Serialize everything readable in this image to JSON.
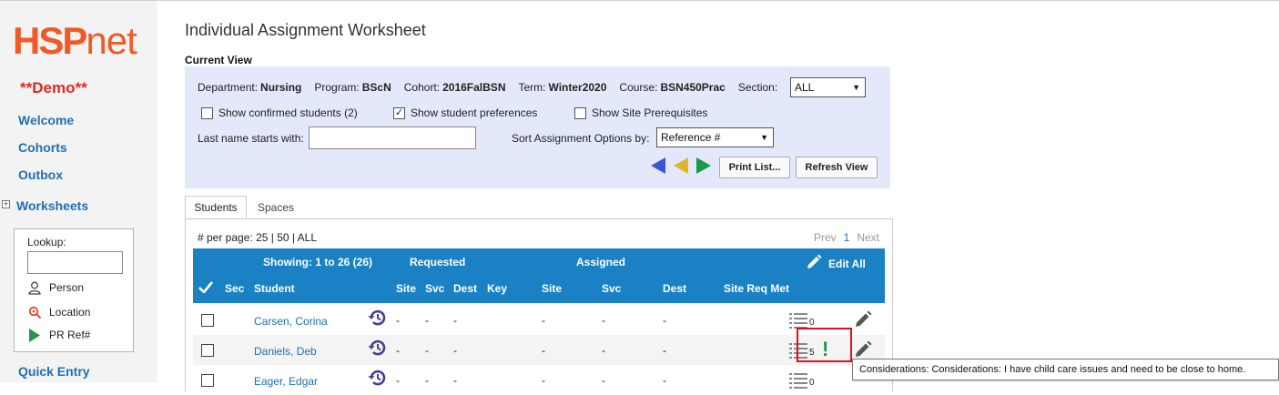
{
  "logo": {
    "part1": "HSP",
    "part2": "net"
  },
  "demo_label": "**Demo**",
  "nav": {
    "welcome": "Welcome",
    "cohorts": "Cohorts",
    "outbox": "Outbox",
    "worksheets": "Worksheets",
    "worksheets_toggle": "+",
    "quick_entry": "Quick Entry"
  },
  "lookup": {
    "label": "Lookup:",
    "value": "",
    "person": "Person",
    "location": "Location",
    "pr_ref": "PR Ref#"
  },
  "page_title": "Individual Assignment Worksheet",
  "current_view": "Current View",
  "filters": {
    "department_label": "Department:",
    "department": "Nursing",
    "program_label": "Program:",
    "program": "BScN",
    "cohort_label": "Cohort:",
    "cohort": "2016FalBSN",
    "term_label": "Term:",
    "term": "Winter2020",
    "course_label": "Course:",
    "course": "BSN450Prac",
    "section_label": "Section:",
    "section": "ALL",
    "show_confirmed": "Show confirmed students (2)",
    "show_confirmed_checked": false,
    "show_prefs": "Show student preferences",
    "show_prefs_checked": true,
    "show_prereq": "Show Site Prerequisites",
    "show_prereq_checked": false,
    "lastname_label": "Last name starts with:",
    "lastname_value": "",
    "sort_label": "Sort Assignment Options by:",
    "sort_value": "Reference #"
  },
  "buttons": {
    "print": "Print List...",
    "refresh": "Refresh View"
  },
  "colors": {
    "nav_left": "#3b55d9",
    "nav_mid": "#e3b52c",
    "nav_right": "#1a9a4a",
    "header": "#1a82c4",
    "link": "#1f6fb3",
    "logo": "#f05a28",
    "demo": "#e32626",
    "alert": "#1a9a4a"
  },
  "tabs": {
    "students": "Students",
    "spaces": "Spaces"
  },
  "perpage": {
    "label": "# per page:",
    "options": "25 | 50 | ALL"
  },
  "pager": {
    "prev": "Prev",
    "current": "1",
    "next": "Next"
  },
  "table": {
    "showing": "Showing: 1 to 26 (26)",
    "requested": "Requested",
    "assigned": "Assigned",
    "edit_all": "Edit All",
    "cols": {
      "sec": "Sec",
      "student": "Student",
      "site": "Site",
      "svc": "Svc",
      "dest": "Dest",
      "key": "Key",
      "a_site": "Site",
      "a_svc": "Svc",
      "a_dest": "Dest",
      "site_req": "Site Req Met"
    },
    "rows": [
      {
        "name": "Carsen, Corina",
        "r_site": "-",
        "r_svc": "-",
        "r_dest": "-",
        "a_site": "-",
        "a_svc": "-",
        "a_dest": "-",
        "count": "0",
        "alert": ""
      },
      {
        "name": "Daniels, Deb",
        "r_site": "-",
        "r_svc": "-",
        "r_dest": "-",
        "a_site": "-",
        "a_svc": "-",
        "a_dest": "-",
        "count": "5",
        "alert": "!"
      },
      {
        "name": "Eager, Edgar",
        "r_site": "-",
        "r_svc": "-",
        "r_dest": "-",
        "a_site": "-",
        "a_svc": "-",
        "a_dest": "-",
        "count": "0",
        "alert": ""
      }
    ]
  },
  "tooltip": "Considerations: Considerations: I have child care issues and need to be close to home."
}
